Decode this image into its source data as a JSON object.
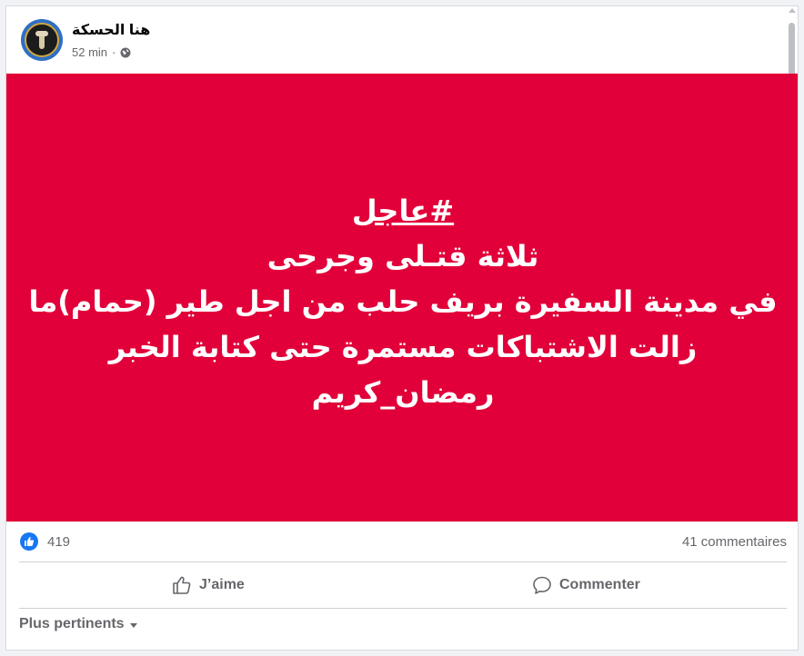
{
  "post": {
    "author": "هنا الحسكة",
    "time": "52 min",
    "privacy_icon": "globe-icon",
    "image_text": {
      "hashtag": "#عاجل",
      "line1": "ثلاثة قتـلى وجرحى",
      "line2": "في مدينة السفيرة بريف حلب من اجل طير (حمام)ما",
      "line3": "زالت الاشتباكات مستمرة حتى كتابة الخبر",
      "line4": "رمضان_كريم"
    },
    "background_color": "#e10039"
  },
  "stats": {
    "reactions": "419",
    "comments": "41 commentaires"
  },
  "actions": {
    "like_label": "J’aime",
    "comment_label": "Commenter"
  },
  "comments_sort": {
    "label": "Plus pertinents"
  },
  "colors": {
    "accent": "#1877f2",
    "muted_text": "#65676b"
  }
}
